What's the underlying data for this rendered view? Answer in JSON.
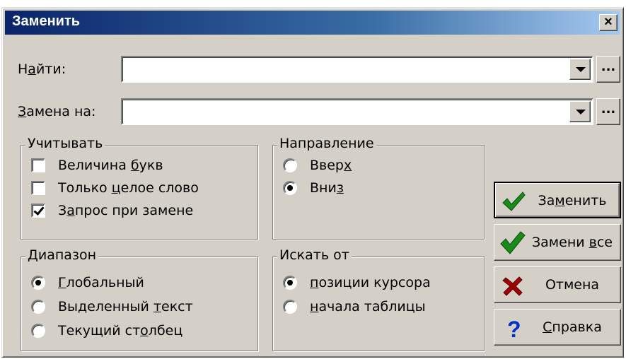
{
  "dialog": {
    "title": "Заменить",
    "close_label": "×"
  },
  "find": {
    "label_pre": "Н",
    "label_u": "а",
    "label_post": "йти:",
    "value": "",
    "ellipsis": "..."
  },
  "replace": {
    "label_pre": "",
    "label_u": "З",
    "label_post": "амена на:",
    "value": "",
    "ellipsis": "..."
  },
  "options": {
    "legend": "Учитывать",
    "items": [
      {
        "pre": "Величина ",
        "u": "б",
        "post": "укв",
        "checked": false
      },
      {
        "pre": "Только ",
        "u": "ц",
        "post": "елое слово",
        "checked": false
      },
      {
        "pre": "З",
        "u": "а",
        "post": "прос при замене",
        "checked": true
      }
    ]
  },
  "direction": {
    "legend": "Направление",
    "items": [
      {
        "pre": "Ввер",
        "u": "х",
        "post": "",
        "checked": false
      },
      {
        "pre": "Вни",
        "u": "з",
        "post": "",
        "checked": true
      }
    ]
  },
  "range": {
    "legend": "Диапазон",
    "items": [
      {
        "pre": "",
        "u": "Г",
        "post": "лобальный",
        "checked": true
      },
      {
        "pre": "Выделенный ",
        "u": "т",
        "post": "екст",
        "checked": false
      },
      {
        "pre": "Текущий ст",
        "u": "о",
        "post": "лбец",
        "checked": false
      }
    ]
  },
  "search_from": {
    "legend": "Искать от",
    "items": [
      {
        "pre": "",
        "u": "п",
        "post": "озиции курсора",
        "checked": true
      },
      {
        "pre": "",
        "u": "н",
        "post": "ачала таблицы",
        "checked": false
      }
    ]
  },
  "buttons": {
    "replace": {
      "pre": "За",
      "u": "м",
      "post": "енить",
      "icon": "green-check-icon"
    },
    "replace_all": {
      "pre": "Замени ",
      "u": "в",
      "post": "се",
      "icon": "big-green-check-icon"
    },
    "cancel": {
      "pre": "Отмена",
      "u": "",
      "post": "",
      "icon": "red-x-icon"
    },
    "help": {
      "pre": "",
      "u": "С",
      "post": "правка",
      "icon": "question-icon"
    }
  },
  "colors": {
    "check_green": "#1a8a1a",
    "cancel_red": "#a00000",
    "help_blue": "#0033cc",
    "title_blue": "#0a246a"
  }
}
